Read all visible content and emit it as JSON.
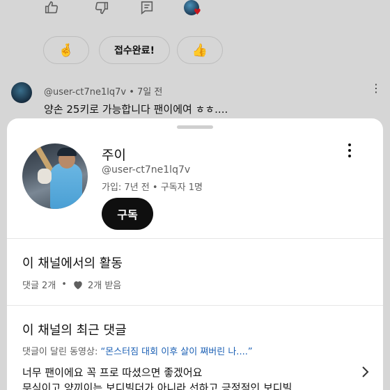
{
  "background": {
    "actions": {
      "like_icon": "thumbs-up-icon",
      "dislike_icon": "thumbs-down-icon",
      "reply_icon": "comment-icon",
      "heart_icon": "heart-icon"
    },
    "chips": [
      {
        "label": "🤞",
        "icon": "crossed-fingers"
      },
      {
        "label": "접수완료!"
      },
      {
        "label": "👍",
        "icon": "thumbs-up"
      }
    ],
    "comment": {
      "author": "@user-ct7ne1lq7v",
      "time": "7일 전",
      "separator": "•",
      "text": "양손 25키로 가능합니다 팬이에여 ㅎㅎ...."
    }
  },
  "profile": {
    "name": "주이",
    "handle": "@user-ct7ne1lq7v",
    "joined": "가입: 7년 전",
    "separator": "•",
    "subscribers": "구독자 1명",
    "subscribe_label": "구독"
  },
  "activity": {
    "title": "이 채널에서의 활동",
    "comments": "댓글 2개",
    "separator": "•",
    "hearts": "2개 받음"
  },
  "recent": {
    "title": "이 채널의 최근 댓글",
    "video_prefix": "댓글이 달린 동영상:",
    "video_title": "“몬스터짐 대회 이후 살이 쪄버린 나....”",
    "line1": "너무 팬이에요 꼭 프로 따셨으면 좋겠어요",
    "line2": "무식이고 양끼이는 보디빌더가 아니라 선하고 긍정적인 보디빌…"
  },
  "colors": {
    "link": "#1a5fb4",
    "subscribe_bg": "#0f0f0f",
    "scrim": "#d6d6d6"
  }
}
